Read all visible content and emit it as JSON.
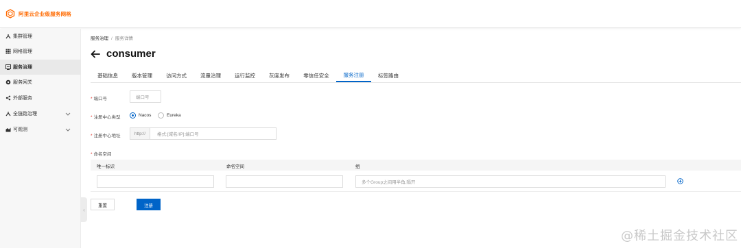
{
  "app": {
    "title": "阿里云企业级服务网格",
    "brand_color": "#ff6a00"
  },
  "sidebar": {
    "items": [
      {
        "label": "集群管理",
        "icon": "cluster-icon"
      },
      {
        "label": "网格管理",
        "icon": "grid-icon"
      },
      {
        "label": "服务治理",
        "icon": "governance-icon",
        "active": true
      },
      {
        "label": "服务网关",
        "icon": "gateway-icon"
      },
      {
        "label": "外部服务",
        "icon": "share-icon"
      },
      {
        "label": "全链路治理",
        "icon": "link-icon",
        "expandable": true
      },
      {
        "label": "可观测",
        "icon": "chart-icon",
        "expandable": true
      }
    ]
  },
  "breadcrumb": {
    "parent": "服务治理",
    "separator": "/",
    "current": "服务详情"
  },
  "page": {
    "title": "consumer"
  },
  "tabs": [
    {
      "label": "基础信息"
    },
    {
      "label": "版本管理"
    },
    {
      "label": "访问方式"
    },
    {
      "label": "流量治理"
    },
    {
      "label": "运行监控"
    },
    {
      "label": "灰度发布"
    },
    {
      "label": "零信任安全"
    },
    {
      "label": "服务注册",
      "active": true
    },
    {
      "label": "标签路由"
    }
  ],
  "form": {
    "port": {
      "label": "端口号",
      "placeholder": "端口号"
    },
    "registry_type": {
      "label": "注册中心类型",
      "options": [
        "Nacos",
        "Eureka"
      ],
      "selected": "Nacos"
    },
    "registry_address": {
      "label": "注册中心地址",
      "prefix": "http://",
      "placeholder": "格式:[域名/IP]:端口号"
    },
    "namespace": {
      "label": "命名空间",
      "columns": [
        "唯一标识",
        "命名空间",
        "组"
      ],
      "group_placeholder": "多个Group之间用半角,隔开"
    }
  },
  "actions": {
    "reset": "重置",
    "submit": "注册"
  },
  "watermark": "@稀土掘金技术社区",
  "colors": {
    "primary": "#0064c8",
    "required": "#e0352b"
  }
}
